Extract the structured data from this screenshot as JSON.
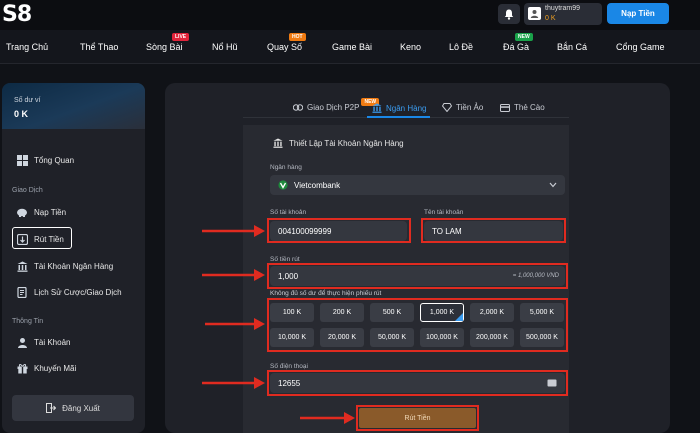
{
  "header": {
    "logo_text": "S8",
    "username": "thuytram99",
    "balance": "0 K",
    "deposit_button": "Nạp Tiền"
  },
  "nav": {
    "items": [
      {
        "label": "Trang Chủ",
        "badge": ""
      },
      {
        "label": "Thể Thao",
        "badge": ""
      },
      {
        "label": "Sòng Bài",
        "badge": "LIVE"
      },
      {
        "label": "Nổ Hũ",
        "badge": ""
      },
      {
        "label": "Quay Số",
        "badge": "HOT"
      },
      {
        "label": "Game Bài",
        "badge": ""
      },
      {
        "label": "Keno",
        "badge": ""
      },
      {
        "label": "Lô Đề",
        "badge": ""
      },
      {
        "label": "Đá Gà",
        "badge": "NEW"
      },
      {
        "label": "Bắn Cá",
        "badge": ""
      },
      {
        "label": "Cổng Game",
        "badge": ""
      }
    ]
  },
  "sidebar": {
    "wallet_label": "Số dư ví",
    "wallet_value": "0 K",
    "overview": "Tổng Quan",
    "section_transactions": "Giao Dịch",
    "deposit": "Nạp Tiền",
    "withdraw": "Rút Tiền",
    "bank_account": "Tài Khoản Ngân Hàng",
    "history": "Lịch Sử Cược/Giao Dịch",
    "section_info": "Thông Tin",
    "account": "Tài Khoản",
    "promotion": "Khuyến Mãi",
    "logout": "Đăng Xuất"
  },
  "tabs": {
    "p2p": "Giao Dịch P2P",
    "p2p_badge": "NEW",
    "bank": "Ngân Hàng",
    "crypto": "Tiền Ảo",
    "card": "Thẻ Cào"
  },
  "form": {
    "title": "Thiết Lập Tài Khoản Ngân Hàng",
    "bank_label": "Ngân hàng",
    "bank_value": "Vietcombank",
    "account_no_label": "Số tài khoản",
    "account_no_value": "004100099999",
    "account_name_label": "Tên tài khoản",
    "account_name_value": "TO LAM",
    "amount_label": "Số tiền rút",
    "amount_value": "1,000",
    "amount_converted": "= 1,000,000 VND",
    "insufficient_note": "Không đủ số dư để thực hiện phiếu rút",
    "amounts_row1": [
      "100 K",
      "200 K",
      "500 K",
      "1,000 K",
      "2,000 K",
      "5,000 K"
    ],
    "amounts_row2": [
      "10,000 K",
      "20,000 K",
      "50,000 K",
      "100,000 K",
      "200,000 K",
      "500,000 K"
    ],
    "selected_amount_index": 3,
    "phone_label": "Số điện thoại",
    "phone_value": "12655",
    "submit": "Rút Tiền"
  },
  "colors": {
    "accent_blue": "#1a87e6",
    "highlight_red": "#e02b20",
    "submit_brown": "#8a5a2a"
  }
}
